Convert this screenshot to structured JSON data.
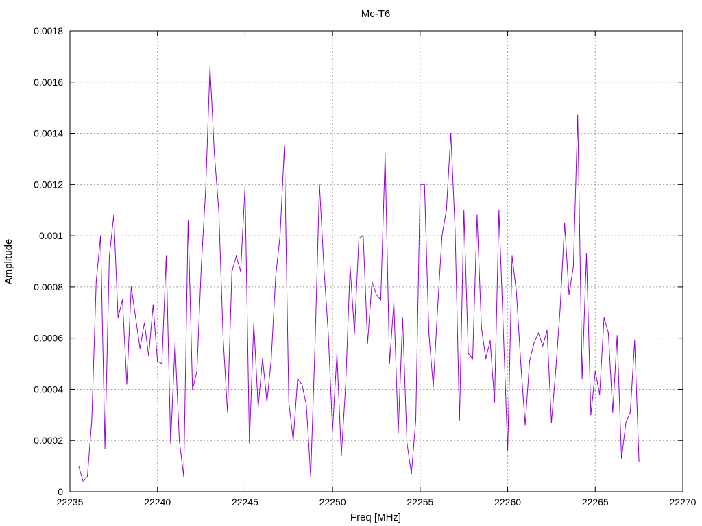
{
  "chart_data": {
    "type": "line",
    "title": "Mc-T6",
    "xlabel": "Freq [MHz]",
    "ylabel": "Amplitude",
    "xlim": [
      22235,
      22270
    ],
    "ylim": [
      0,
      0.0018
    ],
    "xticks": [
      "22235",
      "22240",
      "22245",
      "22250",
      "22255",
      "22260",
      "22265",
      "22270"
    ],
    "xtick_values": [
      22235,
      22240,
      22245,
      22250,
      22255,
      22260,
      22265,
      22270
    ],
    "yticks": [
      "0",
      "0.0002",
      "0.0004",
      "0.0006",
      "0.0008",
      "0.001",
      "0.0012",
      "0.0014",
      "0.0016",
      "0.0018"
    ],
    "ytick_values": [
      0,
      0.0002,
      0.0004,
      0.0006,
      0.0008,
      0.001,
      0.0012,
      0.0014,
      0.0016,
      0.0018
    ],
    "grid": true,
    "line_color": "#9400d3",
    "series": [
      {
        "x": [
          22235.5,
          22235.75,
          22236.0,
          22236.25,
          22236.5,
          22236.75,
          22237.0,
          22237.25,
          22237.5,
          22237.75,
          22238.0,
          22238.25,
          22238.5,
          22238.75,
          22239.0,
          22239.25,
          22239.5,
          22239.75,
          22240.0,
          22240.25,
          22240.5,
          22240.75,
          22241.0,
          22241.25,
          22241.5,
          22241.75,
          22242.0,
          22242.25,
          22242.5,
          22242.75,
          22243.0,
          22243.25,
          22243.5,
          22243.75,
          22244.0,
          22244.25,
          22244.5,
          22244.75,
          22245.0,
          22245.25,
          22245.5,
          22245.75,
          22246.0,
          22246.25,
          22246.5,
          22246.75,
          22247.0,
          22247.25,
          22247.5,
          22247.75,
          22248.0,
          22248.25,
          22248.5,
          22248.75,
          22249.0,
          22249.25,
          22249.5,
          22249.75,
          22250.0,
          22250.25,
          22250.5,
          22250.75,
          22251.0,
          22251.25,
          22251.5,
          22251.75,
          22252.0,
          22252.25,
          22252.5,
          22252.75,
          22253.0,
          22253.25,
          22253.5,
          22253.75,
          22254.0,
          22254.25,
          22254.5,
          22254.75,
          22255.0,
          22255.25,
          22255.5,
          22255.75,
          22256.0,
          22256.25,
          22256.5,
          22256.75,
          22257.0,
          22257.25,
          22257.5,
          22257.75,
          22258.0,
          22258.25,
          22258.5,
          22258.75,
          22259.0,
          22259.25,
          22259.5,
          22259.75,
          22260.0,
          22260.25,
          22260.5,
          22260.75,
          22261.0,
          22261.25,
          22261.5,
          22261.75,
          22262.0,
          22262.25,
          22262.5,
          22262.75,
          22263.0,
          22263.25,
          22263.5,
          22263.75,
          22264.0,
          22264.25,
          22264.5,
          22264.75,
          22265.0,
          22265.25,
          22265.5,
          22265.75,
          22266.0,
          22266.25,
          22266.5,
          22266.75,
          22267.0,
          22267.25,
          22267.5
        ],
        "values": [
          0.0001,
          4e-05,
          6e-05,
          0.00028,
          0.00082,
          0.001,
          0.00017,
          0.00092,
          0.00108,
          0.00068,
          0.00075,
          0.00042,
          0.0008,
          0.00068,
          0.00056,
          0.00066,
          0.00053,
          0.00073,
          0.00051,
          0.0005,
          0.00092,
          0.00019,
          0.00058,
          0.0002,
          6e-05,
          0.00106,
          0.0004,
          0.00047,
          0.00088,
          0.00118,
          0.00166,
          0.00132,
          0.0011,
          0.0006,
          0.00031,
          0.00086,
          0.00092,
          0.00086,
          0.00119,
          0.00019,
          0.00066,
          0.00033,
          0.00052,
          0.00035,
          0.00052,
          0.00084,
          0.001,
          0.00135,
          0.00035,
          0.0002,
          0.00044,
          0.00042,
          0.00034,
          6e-05,
          0.00058,
          0.0012,
          0.00088,
          0.00062,
          0.00024,
          0.00054,
          0.00014,
          0.00042,
          0.00088,
          0.00062,
          0.00099,
          0.001,
          0.00058,
          0.00082,
          0.00077,
          0.00075,
          0.00132,
          0.0005,
          0.00074,
          0.00023,
          0.00068,
          0.00019,
          7e-05,
          0.00028,
          0.0012,
          0.0012,
          0.00062,
          0.00041,
          0.00072,
          0.001,
          0.0011,
          0.0014,
          0.00102,
          0.00028,
          0.0011,
          0.00054,
          0.00052,
          0.00108,
          0.00064,
          0.00052,
          0.00059,
          0.00035,
          0.0011,
          0.00063,
          0.00016,
          0.00092,
          0.00078,
          0.0005,
          0.00026,
          0.00051,
          0.00058,
          0.00062,
          0.00057,
          0.00063,
          0.00027,
          0.00048,
          0.00072,
          0.00105,
          0.00077,
          0.00088,
          0.00147,
          0.00044,
          0.00093,
          0.0003,
          0.00047,
          0.00038,
          0.00068,
          0.00062,
          0.00031,
          0.00061,
          0.00013,
          0.00027,
          0.00031,
          0.00059,
          0.00012
        ]
      }
    ]
  }
}
